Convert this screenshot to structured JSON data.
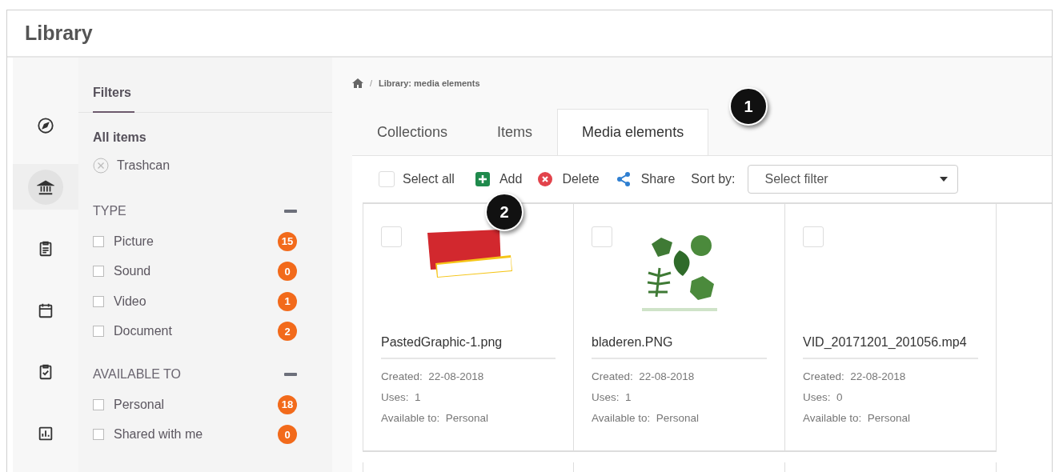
{
  "title": "Library",
  "rail": [
    {
      "kind": "compass",
      "selected": false
    },
    {
      "kind": "bank",
      "selected": true
    },
    {
      "kind": "clipboard",
      "selected": false
    },
    {
      "kind": "calendar",
      "selected": false
    },
    {
      "kind": "checklist",
      "selected": false
    },
    {
      "kind": "chart",
      "selected": false
    }
  ],
  "filters": {
    "heading": "Filters",
    "all_items": "All items",
    "trashcan": "Trashcan",
    "groups": [
      {
        "title": "TYPE",
        "expanded": true,
        "options": [
          {
            "label": "Picture",
            "checked": false,
            "count": "15"
          },
          {
            "label": "Sound",
            "checked": false,
            "count": "0"
          },
          {
            "label": "Video",
            "checked": false,
            "count": "1"
          },
          {
            "label": "Document",
            "checked": false,
            "count": "2"
          }
        ]
      },
      {
        "title": "AVAILABLE TO",
        "expanded": true,
        "options": [
          {
            "label": "Personal",
            "checked": false,
            "count": "18"
          },
          {
            "label": "Shared with me",
            "checked": false,
            "count": "0"
          }
        ]
      }
    ]
  },
  "breadcrumb": {
    "separator": "/",
    "current": "Library: media elements"
  },
  "tabs": [
    {
      "label": "Collections",
      "selected": false
    },
    {
      "label": "Items",
      "selected": false
    },
    {
      "label": "Media elements",
      "selected": true
    }
  ],
  "toolbar": {
    "select_all": {
      "label": "Select all",
      "checked": false
    },
    "actions": [
      {
        "kind": "add",
        "label": "Add"
      },
      {
        "kind": "delete",
        "label": "Delete"
      },
      {
        "kind": "share",
        "label": "Share"
      }
    ],
    "sort_label": "Sort by:",
    "sort_placeholder": "Select filter"
  },
  "items": [
    {
      "name": "PastedGraphic-1.png",
      "kind": "banner",
      "checked": false,
      "created_label": "Created:",
      "created": "22-08-2018",
      "uses_label": "Uses:",
      "uses": "1",
      "available_label": "Available to:",
      "available": "Personal"
    },
    {
      "name": "bladeren.PNG",
      "kind": "leaves",
      "checked": false,
      "created_label": "Created:",
      "created": "22-08-2018",
      "uses_label": "Uses:",
      "uses": "1",
      "available_label": "Available to:",
      "available": "Personal"
    },
    {
      "name": "VID_20171201_201056.mp4",
      "kind": "video",
      "checked": false,
      "created_label": "Created:",
      "created": "22-08-2018",
      "uses_label": "Uses:",
      "uses": "0",
      "available_label": "Available to:",
      "available": "Personal"
    }
  ],
  "callouts": [
    {
      "number": "1"
    },
    {
      "number": "2"
    }
  ]
}
